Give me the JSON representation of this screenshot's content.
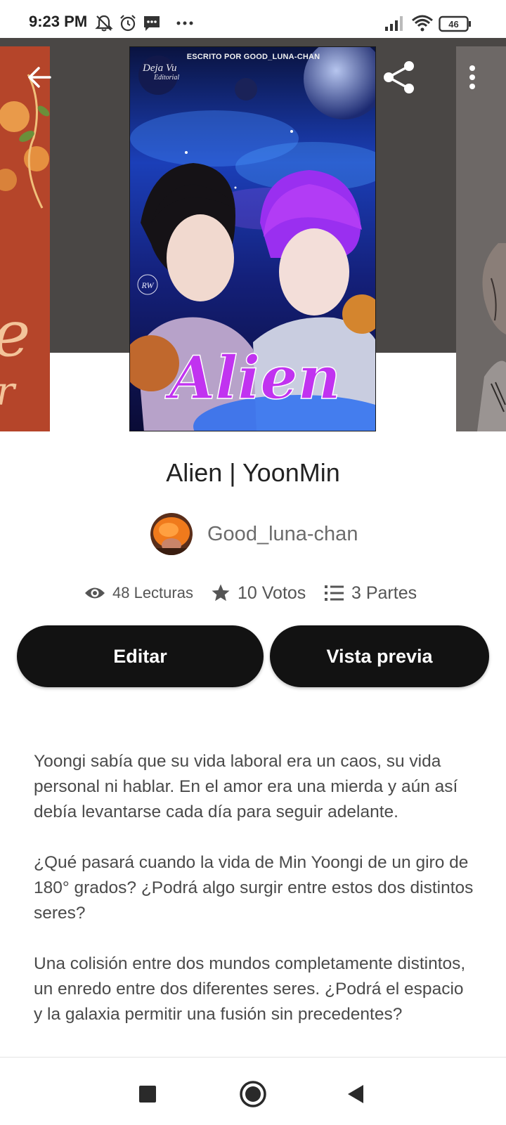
{
  "status_bar": {
    "time": "9:23 PM",
    "battery": "46",
    "icons": [
      "notifications-muted-icon",
      "alarm-icon",
      "message-icon",
      "more-notifications-icon",
      "signal-icon",
      "wifi-icon",
      "battery-icon"
    ]
  },
  "header": {
    "back_icon": "arrow-left-icon",
    "share_icon": "share-icon",
    "menu_icon": "more-vertical-icon"
  },
  "cover": {
    "credit": "ESCRITO POR GOOD_LUNA-CHAN",
    "publisher": "Deja Vu",
    "publisher_sub": "Editorial",
    "title_art": "Alien"
  },
  "story": {
    "title": "Alien | YoonMin",
    "author": "Good_luna-chan",
    "stats": {
      "reads": "48 Lecturas",
      "votes": "10 Votos",
      "parts": "3 Partes"
    }
  },
  "actions": {
    "edit": "Editar",
    "preview": "Vista previa"
  },
  "description": [
    "Yoongi sabía que su vida laboral era un caos, su vida personal ni hablar. En el amor era una mierda y aún así debía levantarse cada día para seguir adelante.",
    "¿Qué pasará cuando la vida de Min Yoongi de un giro de 180° grados? ¿Podrá algo surgir entre estos dos distintos seres?",
    "Una colisión entre dos mundos completamente distintos, un enredo entre dos diferentes seres. ¿Podrá el espacio y la galaxia permitir una fusión sin precedentes?"
  ],
  "nav_bar": {
    "icons": [
      "recents-square-icon",
      "home-circle-icon",
      "back-triangle-icon"
    ]
  },
  "colors": {
    "button": "#121212",
    "header_bg": "#4a4745",
    "text": "#222222",
    "muted_text": "#555555"
  }
}
